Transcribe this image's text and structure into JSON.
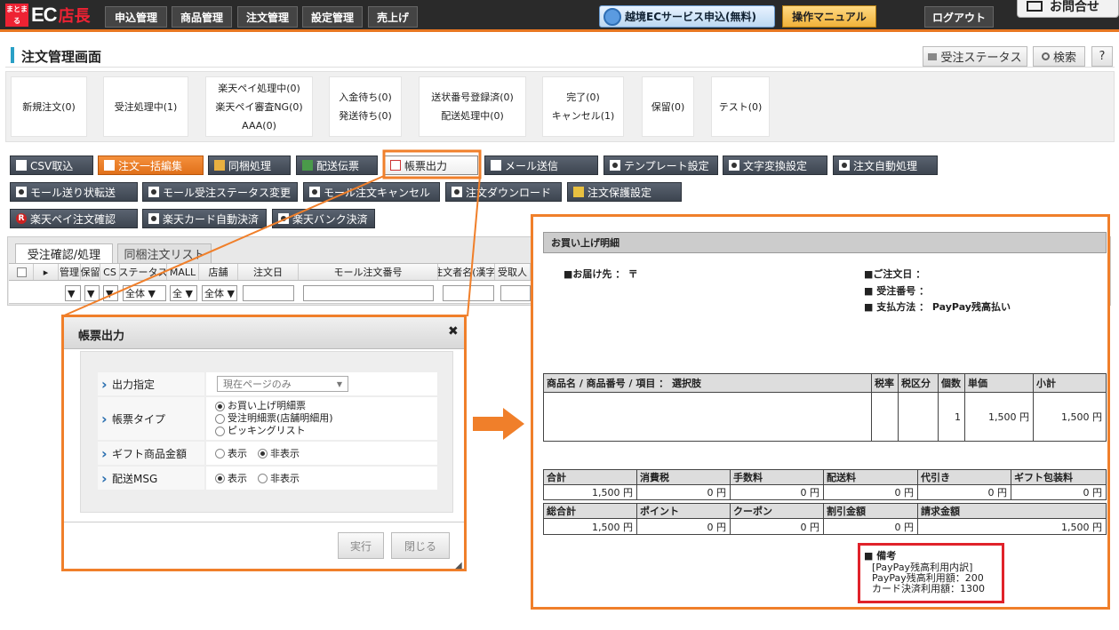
{
  "topnav": {
    "logo_mark": "まとまる",
    "logo_ec": "EC",
    "logo_tencho": "店長",
    "items": [
      "申込管理",
      "商品管理",
      "注文管理",
      "設定管理",
      "売上げ"
    ],
    "cross_border": "越境ECサービス申込(無料)",
    "manual": "操作マニュアル",
    "logout": "ログアウト",
    "contact": "お問合せ"
  },
  "header": {
    "title": "注文管理画面",
    "status_btn": "受注ステータス",
    "search_btn": "検索",
    "help_btn": "?"
  },
  "status_tiles": [
    [
      "新規注文(0)"
    ],
    [
      "受注処理中(1)"
    ],
    [
      "楽天ペイ処理中(0)",
      "楽天ペイ審査NG(0)",
      "AAA(0)"
    ],
    [
      "入金待ち(0)",
      "発送待ち(0)"
    ],
    [
      "送状番号登録済(0)",
      "配送処理中(0)"
    ],
    [
      "完了(0)",
      "キャンセル(1)"
    ],
    [
      "保留(0)"
    ],
    [
      "テスト(0)"
    ]
  ],
  "toolbar": {
    "row1": [
      "CSV取込",
      "注文一括編集",
      "同梱処理",
      "配送伝票",
      "帳票出力",
      "メール送信",
      "テンプレート設定",
      "文字変換設定",
      "注文自動処理"
    ],
    "row2": [
      "モール送り状転送",
      "モール受注ステータス変更",
      "モール注文キャンセル",
      "注文ダウンロード",
      "注文保護設定"
    ],
    "row3": [
      "楽天ペイ注文確認",
      "楽天カード自動決済",
      "楽天バンク決済"
    ]
  },
  "tabs": [
    "受注確認/処理",
    "同梱注文リスト"
  ],
  "grid": {
    "headers": [
      "",
      "",
      "管理",
      "保留",
      "CS",
      "ステータス",
      "MALL",
      "店舗",
      "注文日",
      "モール注文番号",
      "注文者名(漢字)",
      "受取人"
    ],
    "filters": [
      "",
      "",
      "▼",
      "▼",
      "▼",
      "全体 ▼",
      "全 ▼",
      "全体 ▼",
      "",
      "",
      "",
      ""
    ]
  },
  "dialog": {
    "title": "帳票出力",
    "close": "✖",
    "rows": {
      "output_label": "出力指定",
      "output_value": "現在ページのみ",
      "type_label": "帳票タイプ",
      "type_options": [
        "お買い上げ明細票",
        "受注明細票(店舗明細用)",
        "ピッキングリスト"
      ],
      "gift_label": "ギフト商品金額",
      "gift_options": [
        "表示",
        "非表示"
      ],
      "msg_label": "配送MSG",
      "msg_options": [
        "表示",
        "非表示"
      ]
    },
    "run": "実行",
    "close_btn": "閉じる"
  },
  "preview": {
    "heading": "お買い上げ明細",
    "deliver_to_label": "■お届け先 ：",
    "deliver_to_value": "〒",
    "order_date": "■ご注文日 ：",
    "order_number": "■ 受注番号 ：",
    "payment_label": "■ 支払方法 ：",
    "payment_value": "PayPay残高払い",
    "items_headers": [
      "商品名 / 商品番号 / 項目 ： 選択肢",
      "税率",
      "税区分",
      "個数",
      "単価",
      "小計"
    ],
    "items_row": [
      "",
      "",
      "",
      "1",
      "1,500 円",
      "1,500 円"
    ],
    "totals_headers1": [
      "合計",
      "消費税",
      "手数料",
      "配送料",
      "代引き",
      "ギフト包装料"
    ],
    "totals_values1": [
      "1,500 円",
      "0 円",
      "0 円",
      "0 円",
      "0 円",
      "0 円"
    ],
    "totals_headers2": [
      "総合計",
      "ポイント",
      "クーポン",
      "割引金額",
      "請求金額"
    ],
    "totals_values2": [
      "1,500 円",
      "0 円",
      "0 円",
      "0 円",
      "1,500 円"
    ],
    "note_title": "■ 備考",
    "note_lines": [
      "[PayPay残高利用内訳]",
      "PayPay残高利用額：200",
      "カード決済利用額：1300"
    ]
  },
  "colors": {
    "accent": "#f07f2a",
    "nav": "#2a2a2a",
    "highlight": "#e0222a"
  }
}
